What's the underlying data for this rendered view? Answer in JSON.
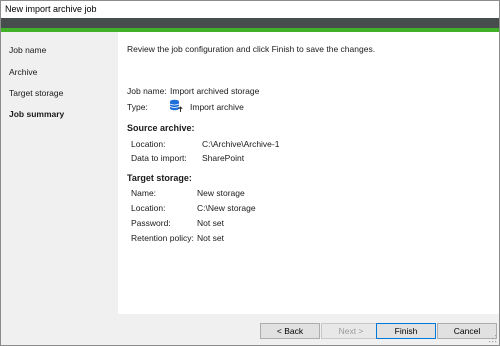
{
  "window": {
    "title": "New import archive job"
  },
  "sidebar": {
    "items": [
      {
        "label": "Job name",
        "active": false
      },
      {
        "label": "Archive",
        "active": false
      },
      {
        "label": "Target storage",
        "active": false
      },
      {
        "label": "Job summary",
        "active": true
      }
    ]
  },
  "main": {
    "intro": "Review the job configuration and click Finish to save the changes.",
    "job_name_label": "Job name:",
    "job_name_value": "Import archived storage",
    "type_label": "Type:",
    "type_icon": "database-import-icon",
    "type_value": "Import archive",
    "source_heading": "Source archive:",
    "source": {
      "location_label": "Location:",
      "location_value": "C:\\Archive\\Archive-1",
      "data_label": "Data to import:",
      "data_value": "SharePoint"
    },
    "target_heading": "Target storage:",
    "target": {
      "name_label": "Name:",
      "name_value": "New storage",
      "location_label": "Location:",
      "location_value": "C:\\New storage",
      "password_label": "Password:",
      "password_value": "Not set",
      "retention_label": "Retention policy:",
      "retention_value": "Not set"
    }
  },
  "footer": {
    "back_label": "< Back",
    "next_label": "Next >",
    "finish_label": "Finish",
    "cancel_label": "Cancel"
  },
  "colors": {
    "header_dark": "#474c4c",
    "accent_green": "#43b02a",
    "icon_blue": "#1e6fd9"
  }
}
